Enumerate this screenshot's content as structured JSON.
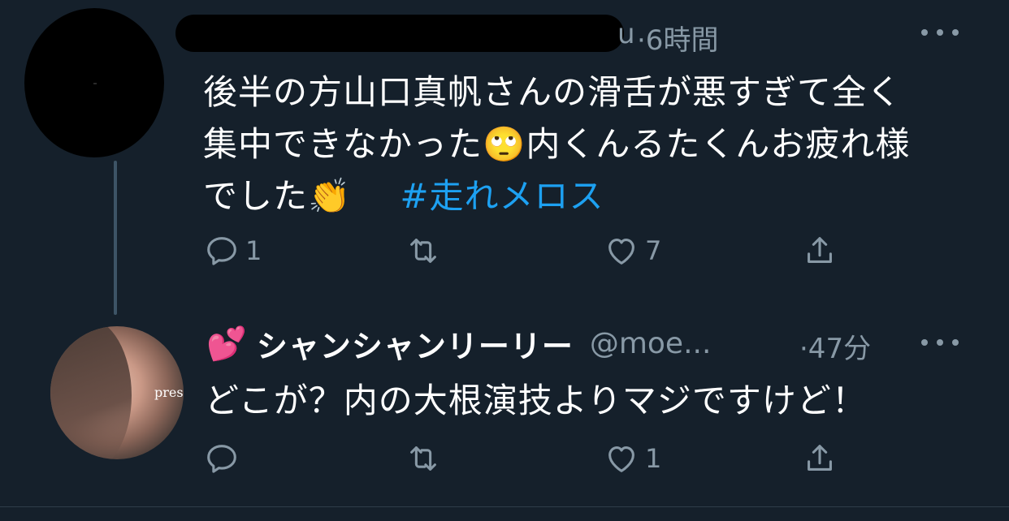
{
  "tweets": [
    {
      "handle_tail": "u",
      "timestamp": "·6時間",
      "text_line1": "後半の方山口真帆さんの滑舌が悪すぎて全く",
      "text_line2a": "集中できなかった",
      "emoji_eyeroll": "🙄",
      "text_line2b": "内くんるたくんお疲れ様",
      "text_line3": "でした",
      "emoji_clap": "👏",
      "hashtag": "#走れメロス",
      "reply_count": "1",
      "retweet_count": "",
      "like_count": "7"
    },
    {
      "emoji_hearts": "💕",
      "display_name": "シャンシャンリーリー",
      "screen_name": "@moe...",
      "timestamp": "·47分",
      "avatar_text": "pres",
      "text": "どこが？内の大根演技よりマジですけど！",
      "reply_count": "",
      "retweet_count": "",
      "like_count": "1"
    }
  ],
  "colors": {
    "background": "#15202b",
    "text": "#ffffff",
    "muted": "#8899a6",
    "link": "#1da1f2"
  },
  "icons": [
    "reply-icon",
    "retweet-icon",
    "like-icon",
    "share-icon",
    "more-icon"
  ]
}
